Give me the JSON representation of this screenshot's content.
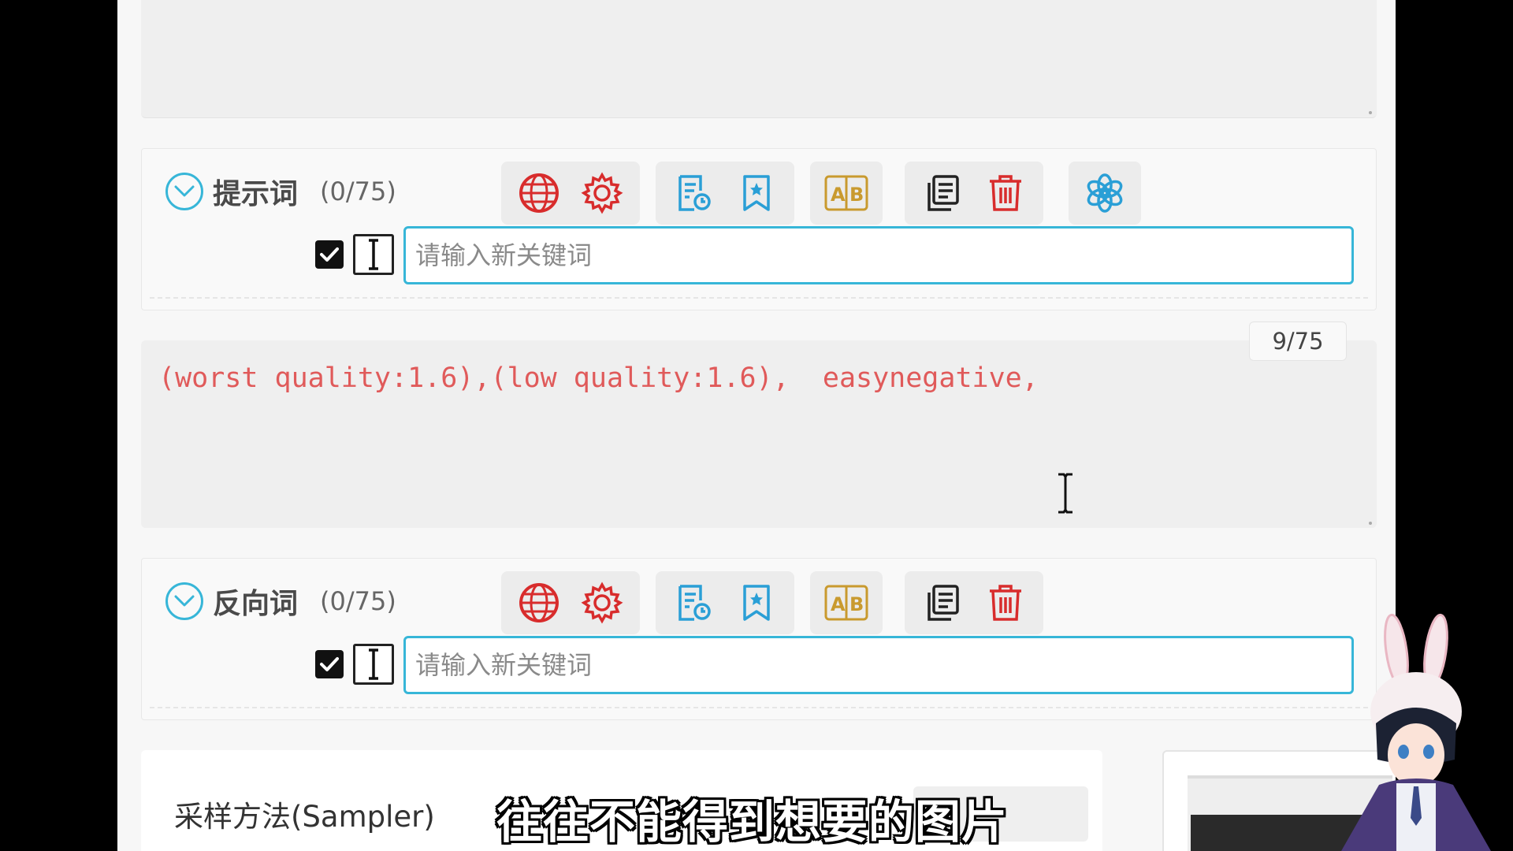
{
  "positive_prompt": {
    "title": "提示词",
    "count": "(0/75)",
    "keyword_placeholder": "请输入新关键词"
  },
  "negative_prompt": {
    "title": "反向词",
    "count": "(0/75)",
    "keyword_placeholder": "请输入新关键词",
    "text": "(worst quality:1.6),(low quality:1.6),  easynegative,",
    "token_counter": "9/75"
  },
  "sampler": {
    "label": "采样方法(Sampler)"
  },
  "subtitle": "往往不能得到想要的图片",
  "colors": {
    "accent": "#37b6d8",
    "red_icon": "#d82c2c",
    "blue_icon": "#2a9fd6",
    "gold_icon": "#c99a2e",
    "prompt_text": "#e05a5a"
  },
  "icons": [
    "globe-icon",
    "gear-icon",
    "history-doc-icon",
    "bookmark-star-icon",
    "translate-ab-icon",
    "copy-icon",
    "trash-icon",
    "openai-icon"
  ]
}
